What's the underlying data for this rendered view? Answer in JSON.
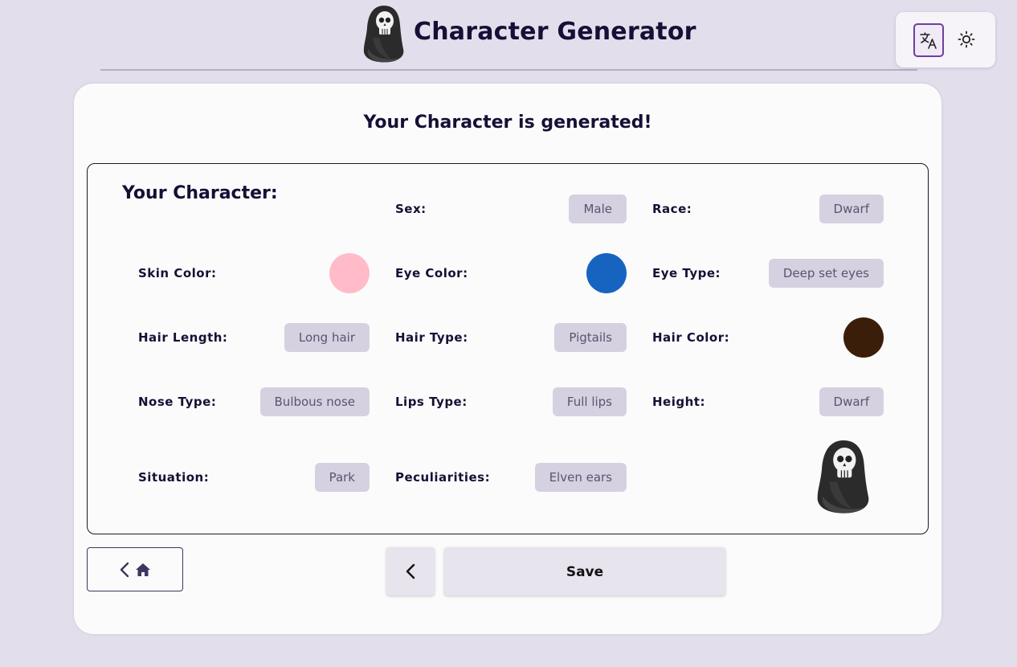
{
  "header": {
    "title": "Character Generator",
    "logo_icon": "hooded-skull-icon",
    "translate_icon": "translate-icon",
    "theme_icon": "sun-icon"
  },
  "card": {
    "title": "Your Character is generated!",
    "box_heading": "Your Character:"
  },
  "fields": {
    "sex": {
      "label": "Sex:",
      "value": "Male"
    },
    "race": {
      "label": "Race:",
      "value": "Dwarf"
    },
    "skin_color": {
      "label": "Skin Color:",
      "color": "#ffbcc8"
    },
    "eye_color": {
      "label": "Eye Color:",
      "color": "#1664c0"
    },
    "eye_type": {
      "label": "Eye Type:",
      "value": "Deep set eyes"
    },
    "hair_length": {
      "label": "Hair Length:",
      "value": "Long hair"
    },
    "hair_type": {
      "label": "Hair Type:",
      "value": "Pigtails"
    },
    "hair_color": {
      "label": "Hair Color:",
      "color": "#3b1e09"
    },
    "nose_type": {
      "label": "Nose Type:",
      "value": "Bulbous nose"
    },
    "lips_type": {
      "label": "Lips Type:",
      "value": "Full lips"
    },
    "height": {
      "label": "Height:",
      "value": "Dwarf"
    },
    "situation": {
      "label": "Situation:",
      "value": "Park"
    },
    "peculiarities": {
      "label": "Peculiarities:",
      "value": "Elven ears"
    }
  },
  "buttons": {
    "home_icons": [
      "chevron-left-icon",
      "home-icon"
    ],
    "back_icon": "chevron-left-icon",
    "save_label": "Save"
  },
  "colors": {
    "background": "#e3deec",
    "card": "#fbfbfb",
    "accent": "#6d3fa0",
    "heading_text": "#170f35",
    "chip_bg": "#d6d1e0"
  }
}
